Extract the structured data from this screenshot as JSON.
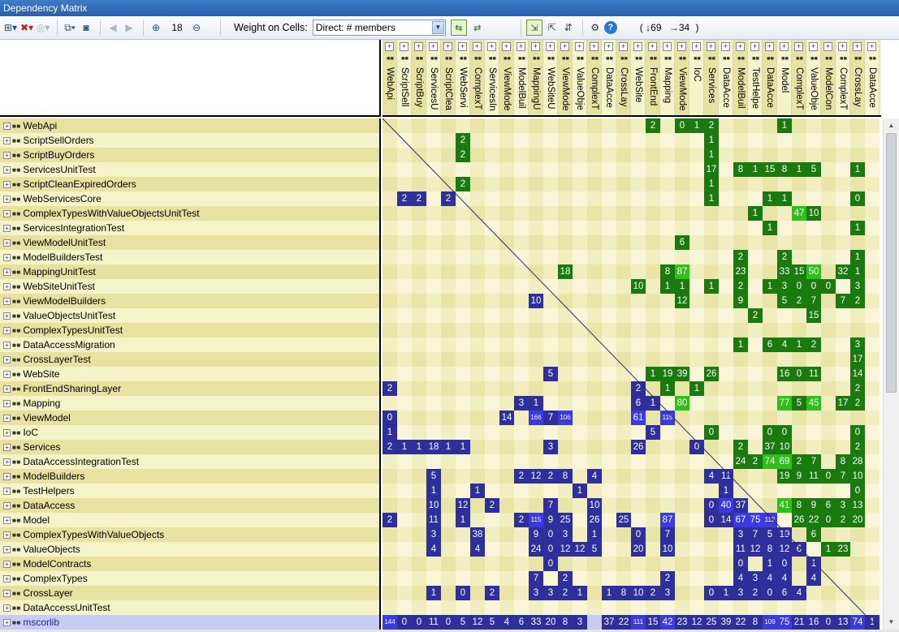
{
  "window_title": "Dependency Matrix",
  "toolbar": {
    "zoom_value": "18",
    "weight_label": "Weight on Cells:",
    "weight_selected": "Direct: # members",
    "count_down": "69",
    "count_right": "34",
    "paren_open": "(",
    "paren_close": ")"
  },
  "colors": {
    "green": "#1a7a10",
    "green_hi": "#2fbf1a",
    "blue": "#2f2f9c",
    "blue_hi": "#3a3ae0",
    "band_dark": "#e7e2a0",
    "band_light": "#f5f3c8",
    "selected_row": "#c7cdf2"
  },
  "columns": [
    "WebApi",
    "ScriptSell",
    "ScriptBuy",
    "ServicesU",
    "ScriptClea",
    "WebServi",
    "ComplexT",
    "ServicesIn",
    "ViewMode",
    "ModelBuil",
    "MappingU",
    "WebSiteU",
    "ViewMode",
    "ValueObje",
    "ComplexT",
    "DataAcce",
    "CrossLay",
    "WebSite",
    "FrontEnd",
    "Mapping",
    "ViewMode",
    "IoC",
    "Services",
    "DataAcce",
    "ModelBuil",
    "TestHelpe",
    "DataAcce",
    "Model",
    "ComplexT",
    "ValueObje",
    "ModelCon",
    "ComplexT",
    "CrossLay",
    "DataAcce"
  ],
  "rows": [
    {
      "label": "WebApi",
      "cells": [
        "",
        "",
        "",
        "",
        "",
        "",
        "",
        "",
        "",
        "",
        "",
        "",
        "",
        "",
        "",
        "",
        "",
        "",
        "2",
        "",
        "0",
        "1",
        "2",
        "",
        "",
        "",
        "",
        "1",
        "",
        "",
        "",
        "",
        "",
        ""
      ]
    },
    {
      "label": "ScriptSellOrders",
      "cells": [
        "",
        "",
        "",
        "",
        "",
        "2",
        "",
        "",
        "",
        "",
        "",
        "",
        "",
        "",
        "",
        "",
        "",
        "",
        "",
        "",
        "",
        "",
        "1",
        "",
        "",
        "",
        "",
        "",
        "",
        "",
        "",
        "",
        "",
        ""
      ]
    },
    {
      "label": "ScriptBuyOrders",
      "cells": [
        "",
        "",
        "",
        "",
        "",
        "2",
        "",
        "",
        "",
        "",
        "",
        "",
        "",
        "",
        "",
        "",
        "",
        "",
        "",
        "",
        "",
        "",
        "1",
        "",
        "",
        "",
        "",
        "",
        "",
        "",
        "",
        "",
        "",
        ""
      ]
    },
    {
      "label": "ServicesUnitTest",
      "cells": [
        "",
        "",
        "",
        "",
        "",
        "",
        "",
        "",
        "",
        "",
        "",
        "",
        "",
        "",
        "",
        "",
        "",
        "",
        "",
        "",
        "",
        "",
        "17",
        "",
        "8",
        "1",
        "15",
        "8",
        "1",
        "5",
        "",
        "",
        "1",
        ""
      ]
    },
    {
      "label": "ScriptCleanExpiredOrders",
      "cells": [
        "",
        "",
        "",
        "",
        "",
        "2",
        "",
        "",
        "",
        "",
        "",
        "",
        "",
        "",
        "",
        "",
        "",
        "",
        "",
        "",
        "",
        "",
        "1",
        "",
        "",
        "",
        "",
        "",
        "",
        "",
        "",
        "",
        "",
        ""
      ]
    },
    {
      "label": "WebServicesCore",
      "cells": [
        "",
        "2",
        "2",
        "",
        "2",
        "",
        "",
        "",
        "",
        "",
        "",
        "",
        "",
        "",
        "",
        "",
        "",
        "",
        "",
        "",
        "",
        "",
        "1",
        "",
        "",
        "",
        "1",
        "1",
        "",
        "",
        "",
        "",
        "0",
        ""
      ]
    },
    {
      "label": "ComplexTypesWithValueObjectsUnitTest",
      "cells": [
        "",
        "",
        "",
        "",
        "",
        "",
        "",
        "",
        "",
        "",
        "",
        "",
        "",
        "",
        "",
        "",
        "",
        "",
        "",
        "",
        "",
        "",
        "",
        "",
        "",
        "1",
        "",
        "",
        "47",
        "10",
        "",
        "",
        "",
        ""
      ]
    },
    {
      "label": "ServicesIntegrationTest",
      "cells": [
        "",
        "",
        "",
        "",
        "",
        "",
        "",
        "",
        "",
        "",
        "",
        "",
        "",
        "",
        "",
        "",
        "",
        "",
        "",
        "",
        "",
        "",
        "",
        "",
        "",
        "",
        "1",
        "",
        "",
        "",
        "",
        "",
        "1",
        ""
      ]
    },
    {
      "label": "ViewModelUnitTest",
      "cells": [
        "",
        "",
        "",
        "",
        "",
        "",
        "",
        "",
        "",
        "",
        "",
        "",
        "",
        "",
        "",
        "",
        "",
        "",
        "",
        "",
        "6",
        "",
        "",
        "",
        "",
        "",
        "",
        "",
        "",
        "",
        "",
        "",
        "",
        ""
      ]
    },
    {
      "label": "ModelBuildersTest",
      "cells": [
        "",
        "",
        "",
        "",
        "",
        "",
        "",
        "",
        "",
        "",
        "",
        "",
        "",
        "",
        "",
        "",
        "",
        "",
        "",
        "",
        "",
        "",
        "",
        "",
        "2",
        "",
        "",
        "2",
        "",
        "",
        "",
        "",
        "1",
        ""
      ]
    },
    {
      "label": "MappingUnitTest",
      "cells": [
        "",
        "",
        "",
        "",
        "",
        "",
        "",
        "",
        "",
        "",
        "",
        "",
        "18",
        "",
        "",
        "",
        "",
        "",
        "",
        "8",
        "87",
        "",
        "",
        "",
        "23",
        "",
        "",
        "33",
        "15",
        "50",
        "",
        "32",
        "1",
        ""
      ]
    },
    {
      "label": "WebSiteUnitTest",
      "cells": [
        "",
        "",
        "",
        "",
        "",
        "",
        "",
        "",
        "",
        "",
        "",
        "",
        "",
        "",
        "",
        "",
        "",
        "10",
        "",
        "1",
        "1",
        "",
        "1",
        "",
        "2",
        "",
        "1",
        "3",
        "0",
        "0",
        "0",
        "",
        "3",
        ""
      ]
    },
    {
      "label": "ViewModelBuilders",
      "cells": [
        "",
        "",
        "",
        "",
        "",
        "",
        "",
        "",
        "",
        "",
        "10",
        "",
        "",
        "",
        "",
        "",
        "",
        "",
        "",
        "",
        "12",
        "",
        "",
        "",
        "9",
        "",
        "",
        "5",
        "2",
        "7",
        "",
        "7",
        "2",
        ""
      ]
    },
    {
      "label": "ValueObjectsUnitTest",
      "cells": [
        "",
        "",
        "",
        "",
        "",
        "",
        "",
        "",
        "",
        "",
        "",
        "",
        "",
        "",
        "",
        "",
        "",
        "",
        "",
        "",
        "",
        "",
        "",
        "",
        "",
        "2",
        "",
        "",
        "",
        "15",
        "",
        "",
        "",
        ""
      ]
    },
    {
      "label": "ComplexTypesUnitTest",
      "cells": [
        "",
        "",
        "",
        "",
        "",
        "",
        "",
        "",
        "",
        "",
        "",
        "",
        "",
        "",
        "",
        "",
        "",
        "",
        "",
        "",
        "",
        "",
        "",
        "",
        "",
        "",
        "",
        "",
        "",
        "",
        "",
        "",
        "",
        ""
      ]
    },
    {
      "label": "DataAccessMigration",
      "cells": [
        "",
        "",
        "",
        "",
        "",
        "",
        "",
        "",
        "",
        "",
        "",
        "",
        "",
        "",
        "",
        "",
        "",
        "",
        "",
        "",
        "",
        "",
        "",
        "",
        "1",
        "",
        "6",
        "4",
        "1",
        "2",
        "",
        "",
        "3",
        ""
      ]
    },
    {
      "label": "CrossLayerTest",
      "cells": [
        "",
        "",
        "",
        "",
        "",
        "",
        "",
        "",
        "",
        "",
        "",
        "",
        "",
        "",
        "",
        "",
        "",
        "",
        "",
        "",
        "",
        "",
        "",
        "",
        "",
        "",
        "",
        "",
        "",
        "",
        "",
        "",
        "17",
        ""
      ]
    },
    {
      "label": "WebSite",
      "cells": [
        "",
        "",
        "",
        "",
        "",
        "",
        "",
        "",
        "",
        "",
        "",
        "5",
        "",
        "",
        "",
        "",
        "",
        "",
        "1",
        "19",
        "39",
        "",
        "26",
        "",
        "",
        "",
        "",
        "16",
        "0",
        "11",
        "",
        "",
        "14",
        ""
      ]
    },
    {
      "label": "FrontEndSharingLayer",
      "cells": [
        "2",
        "",
        "",
        "",
        "",
        "",
        "",
        "",
        "",
        "",
        "",
        "",
        "",
        "",
        "",
        "",
        "",
        "2",
        "",
        "1",
        "",
        "1",
        "",
        "",
        "",
        "",
        "",
        "",
        "",
        "",
        "",
        "",
        "2",
        ""
      ]
    },
    {
      "label": "Mapping",
      "cells": [
        "",
        "",
        "",
        "",
        "",
        "",
        "",
        "",
        "",
        "3",
        "1",
        "",
        "",
        "",
        "",
        "",
        "",
        "6",
        "1",
        "",
        "80",
        "",
        "",
        "",
        "",
        "",
        "",
        "77",
        "5",
        "45",
        "",
        "17",
        "2",
        ""
      ]
    },
    {
      "label": "ViewModel",
      "cells": [
        "0",
        "",
        "",
        "",
        "",
        "",
        "",
        "",
        "14",
        "",
        "166",
        "7",
        "106",
        "",
        "",
        "",
        "",
        "61",
        "",
        "115",
        "",
        "",
        "",
        "",
        "",
        "",
        "",
        "",
        "",
        "",
        "",
        "",
        "",
        ""
      ]
    },
    {
      "label": "IoC",
      "cells": [
        "1",
        "",
        "",
        "",
        "",
        "",
        "",
        "",
        "",
        "",
        "",
        "",
        "",
        "",
        "",
        "",
        "",
        "",
        "5",
        "",
        "",
        "",
        "0",
        "",
        "",
        "",
        "0",
        "0",
        "",
        "",
        "",
        "",
        "0",
        ""
      ]
    },
    {
      "label": "Services",
      "cells": [
        "2",
        "1",
        "1",
        "18",
        "1",
        "1",
        "",
        "",
        "",
        "",
        "",
        "3",
        "",
        "",
        "",
        "",
        "",
        "26",
        "",
        "",
        "",
        "0",
        "",
        "",
        "2",
        "",
        "37",
        "10",
        "",
        "",
        "",
        "",
        "2",
        ""
      ]
    },
    {
      "label": "DataAccessIntegrationTest",
      "cells": [
        "",
        "",
        "",
        "",
        "",
        "",
        "",
        "",
        "",
        "",
        "",
        "",
        "",
        "",
        "",
        "",
        "",
        "",
        "",
        "",
        "",
        "",
        "",
        "",
        "24",
        "2",
        "74",
        "69",
        "2",
        "7",
        "",
        "8",
        "28",
        ""
      ]
    },
    {
      "label": "ModelBuilders",
      "cells": [
        "",
        "",
        "",
        "5",
        "",
        "",
        "",
        "",
        "",
        "2",
        "12",
        "2",
        "8",
        "",
        "4",
        "",
        "",
        "",
        "",
        "",
        "",
        "",
        "4",
        "11",
        "",
        "",
        "",
        "19",
        "9",
        "11",
        "0",
        "7",
        "10",
        ""
      ]
    },
    {
      "label": "TestHelpers",
      "cells": [
        "",
        "",
        "",
        "1",
        "",
        "",
        "1",
        "",
        "",
        "",
        "",
        "",
        "",
        "1",
        "",
        "",
        "",
        "",
        "",
        "",
        "",
        "",
        "",
        "1",
        "",
        "",
        "",
        "",
        "",
        "",
        "",
        "",
        "0",
        ""
      ]
    },
    {
      "label": "DataAccess",
      "cells": [
        "",
        "",
        "",
        "10",
        "",
        "12",
        "",
        "2",
        "",
        "",
        "",
        "7",
        "",
        "",
        "10",
        "",
        "",
        "",
        "",
        "",
        "",
        "",
        "0",
        "40",
        "37",
        "",
        "",
        "41",
        "8",
        "9",
        "6",
        "3",
        "13",
        ""
      ]
    },
    {
      "label": "Model",
      "cells": [
        "2",
        "",
        "",
        "11",
        "",
        "1",
        "",
        "",
        "",
        "2",
        "115",
        "9",
        "25",
        "",
        "26",
        "",
        "25",
        "",
        "",
        "87",
        "",
        "",
        "0",
        "14",
        "67",
        "75",
        "112",
        "",
        "26",
        "22",
        "0",
        "2",
        "20",
        ""
      ]
    },
    {
      "label": "ComplexTypesWithValueObjects",
      "cells": [
        "",
        "",
        "",
        "3",
        "",
        "",
        "38",
        "",
        "",
        "",
        "9",
        "0",
        "3",
        "",
        "1",
        "",
        "",
        "0",
        "",
        "7",
        "",
        "",
        "",
        "",
        "3",
        "7",
        "5",
        "19",
        "",
        "6",
        "",
        "",
        "",
        ""
      ]
    },
    {
      "label": "ValueObjects",
      "cells": [
        "",
        "",
        "",
        "4",
        "",
        "",
        "4",
        "",
        "",
        "",
        "24",
        "0",
        "12",
        "12",
        "5",
        "",
        "",
        "20",
        "",
        "10",
        "",
        "",
        "",
        "",
        "11",
        "12",
        "8",
        "12",
        "6",
        "",
        "1",
        "23",
        "",
        ""
      ]
    },
    {
      "label": "ModelContracts",
      "cells": [
        "",
        "",
        "",
        "",
        "",
        "",
        "",
        "",
        "",
        "",
        "",
        "0",
        "",
        "",
        "",
        "",
        "",
        "",
        "",
        "",
        "",
        "",
        "",
        "",
        "0",
        "",
        "1",
        "0",
        "",
        "1",
        "",
        "",
        "",
        ""
      ]
    },
    {
      "label": "ComplexTypes",
      "cells": [
        "",
        "",
        "",
        "",
        "",
        "",
        "",
        "",
        "",
        "",
        "7",
        "",
        "2",
        "",
        "",
        "",
        "",
        "",
        "",
        "2",
        "",
        "",
        "",
        "",
        "4",
        "3",
        "4",
        "4",
        "",
        "4",
        "",
        "",
        "",
        ""
      ]
    },
    {
      "label": "CrossLayer",
      "cells": [
        "",
        "",
        "",
        "1",
        "",
        "0",
        "",
        "2",
        "",
        "",
        "3",
        "3",
        "2",
        "1",
        "",
        "1",
        "8",
        "10",
        "2",
        "3",
        "",
        "",
        "0",
        "1",
        "3",
        "2",
        "0",
        "6",
        "4",
        "",
        "",
        "",
        "",
        ""
      ]
    },
    {
      "label": "DataAccessUnitTest",
      "cells": [
        "",
        "",
        "",
        "",
        "",
        "",
        "",
        "",
        "",
        "",
        "",
        "",
        "",
        "",
        "",
        "",
        "",
        "",
        "",
        "",
        "",
        "",
        "",
        "",
        "",
        "",
        "",
        "",
        "",
        "",
        "",
        "",
        "",
        ""
      ]
    },
    {
      "label": "mscorlib",
      "cells": [
        "144",
        "0",
        "0",
        "11",
        "0",
        "5",
        "12",
        "5",
        "4",
        "6",
        "33",
        "20",
        "8",
        "3",
        "",
        "37",
        "22",
        "111",
        "15",
        "42",
        "23",
        "12",
        "25",
        "39",
        "22",
        "8",
        "109",
        "75",
        "21",
        "16",
        "0",
        "13",
        "74",
        "1"
      ]
    }
  ]
}
